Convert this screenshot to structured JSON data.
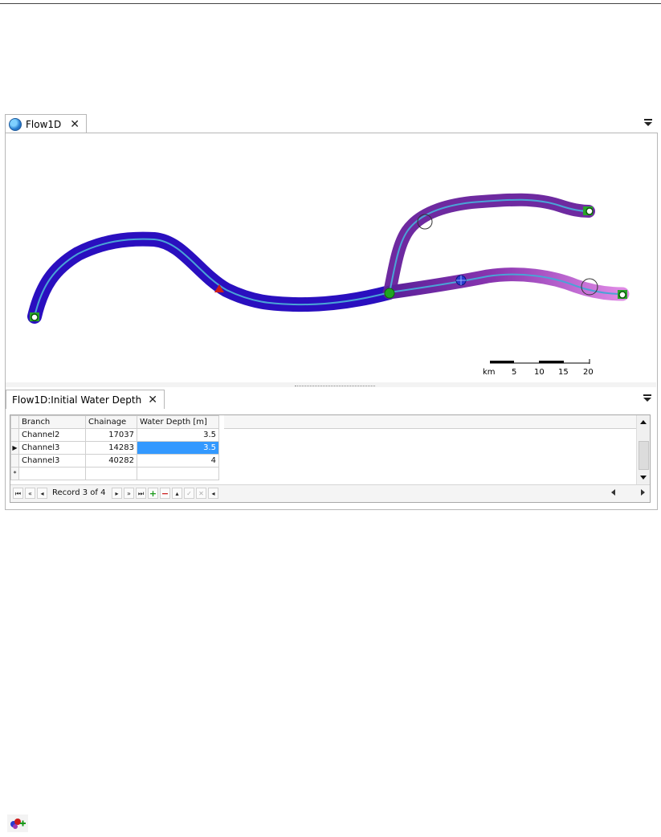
{
  "main_tab": {
    "title": "Flow1D",
    "close_glyph": "✕",
    "icon": "globe-icon"
  },
  "map": {
    "scale_bar": {
      "unit": "km",
      "ticks": [
        "5",
        "10",
        "15",
        "20"
      ]
    },
    "colors": {
      "deep_channel": "#2a0fbf",
      "mid_channel": "#6e2aa0",
      "shallow_channel": "#d77de0",
      "centerline": "#4aa3d6",
      "node_green": "#1fa51f",
      "red_marker": "#cc1a1a"
    }
  },
  "lower_tab": {
    "title": "Flow1D:Initial Water Depth",
    "close_glyph": "✕"
  },
  "grid": {
    "columns": [
      "Branch",
      "Chainage",
      "Water Depth [m]"
    ],
    "rows": [
      {
        "branch": "Channel2",
        "chainage": "17037",
        "depth": "3.5"
      },
      {
        "branch": "Channel3",
        "chainage": "14283",
        "depth": "3.5"
      },
      {
        "branch": "Channel3",
        "chainage": "40282",
        "depth": "4"
      }
    ],
    "new_row_glyph": "*",
    "current_row_glyph": "▶",
    "navigator": {
      "record_text": "Record 3 of 4"
    }
  }
}
